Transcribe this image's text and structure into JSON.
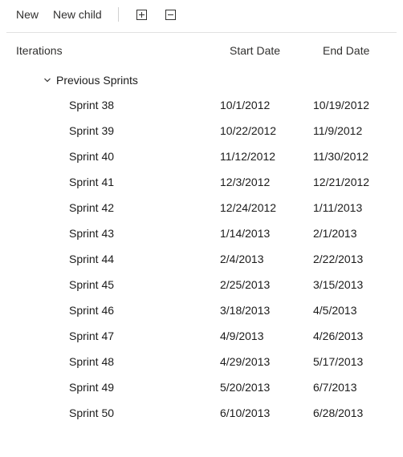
{
  "toolbar": {
    "new_label": "New",
    "new_child_label": "New child"
  },
  "columns": {
    "iterations": "Iterations",
    "start_date": "Start Date",
    "end_date": "End Date"
  },
  "group": {
    "label": "Previous Sprints"
  },
  "rows": [
    {
      "name": "Sprint 38",
      "start": "10/1/2012",
      "end": "10/19/2012"
    },
    {
      "name": "Sprint 39",
      "start": "10/22/2012",
      "end": "11/9/2012"
    },
    {
      "name": "Sprint 40",
      "start": "11/12/2012",
      "end": "11/30/2012"
    },
    {
      "name": "Sprint 41",
      "start": "12/3/2012",
      "end": "12/21/2012"
    },
    {
      "name": "Sprint 42",
      "start": "12/24/2012",
      "end": "1/11/2013"
    },
    {
      "name": "Sprint 43",
      "start": "1/14/2013",
      "end": "2/1/2013"
    },
    {
      "name": "Sprint 44",
      "start": "2/4/2013",
      "end": "2/22/2013"
    },
    {
      "name": "Sprint 45",
      "start": "2/25/2013",
      "end": "3/15/2013"
    },
    {
      "name": "Sprint 46",
      "start": "3/18/2013",
      "end": "4/5/2013"
    },
    {
      "name": "Sprint 47",
      "start": "4/9/2013",
      "end": "4/26/2013"
    },
    {
      "name": "Sprint 48",
      "start": "4/29/2013",
      "end": "5/17/2013"
    },
    {
      "name": "Sprint 49",
      "start": "5/20/2013",
      "end": "6/7/2013"
    },
    {
      "name": "Sprint 50",
      "start": "6/10/2013",
      "end": "6/28/2013"
    }
  ]
}
